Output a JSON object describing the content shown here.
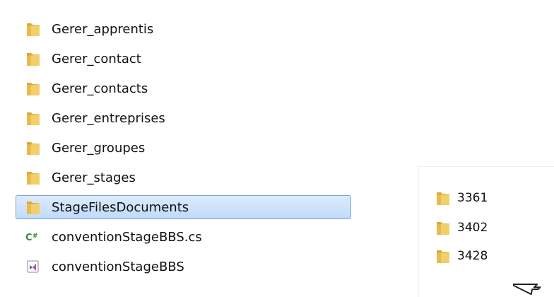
{
  "left_panel": {
    "items": [
      {
        "label": "Gerer_apprentis",
        "icon": "folder-icon"
      },
      {
        "label": "Gerer_contact",
        "icon": "folder-icon"
      },
      {
        "label": "Gerer_contacts",
        "icon": "folder-icon"
      },
      {
        "label": "Gerer_entreprises",
        "icon": "folder-icon"
      },
      {
        "label": "Gerer_groupes",
        "icon": "folder-icon"
      },
      {
        "label": "Gerer_stages",
        "icon": "folder-icon"
      },
      {
        "label": "StageFilesDocuments",
        "icon": "folder-icon",
        "selected": true
      },
      {
        "label": "conventionStageBBS.cs",
        "icon": "csharp-file-icon"
      },
      {
        "label": "conventionStageBBS",
        "icon": "visual-studio-solution-icon"
      }
    ]
  },
  "right_panel": {
    "items": [
      {
        "label": "3361",
        "icon": "folder-icon"
      },
      {
        "label": "3402",
        "icon": "folder-icon"
      },
      {
        "label": "3428",
        "icon": "folder-icon"
      }
    ]
  },
  "colors": {
    "selection_fill": "#cde3fb",
    "selection_border": "#7da2ce",
    "folder_yellow": "#e8c15a",
    "csharp_green": "#3a8a3a",
    "vs_purple": "#7b3fa0"
  },
  "cursor_icon": "arrow-cursor-icon"
}
